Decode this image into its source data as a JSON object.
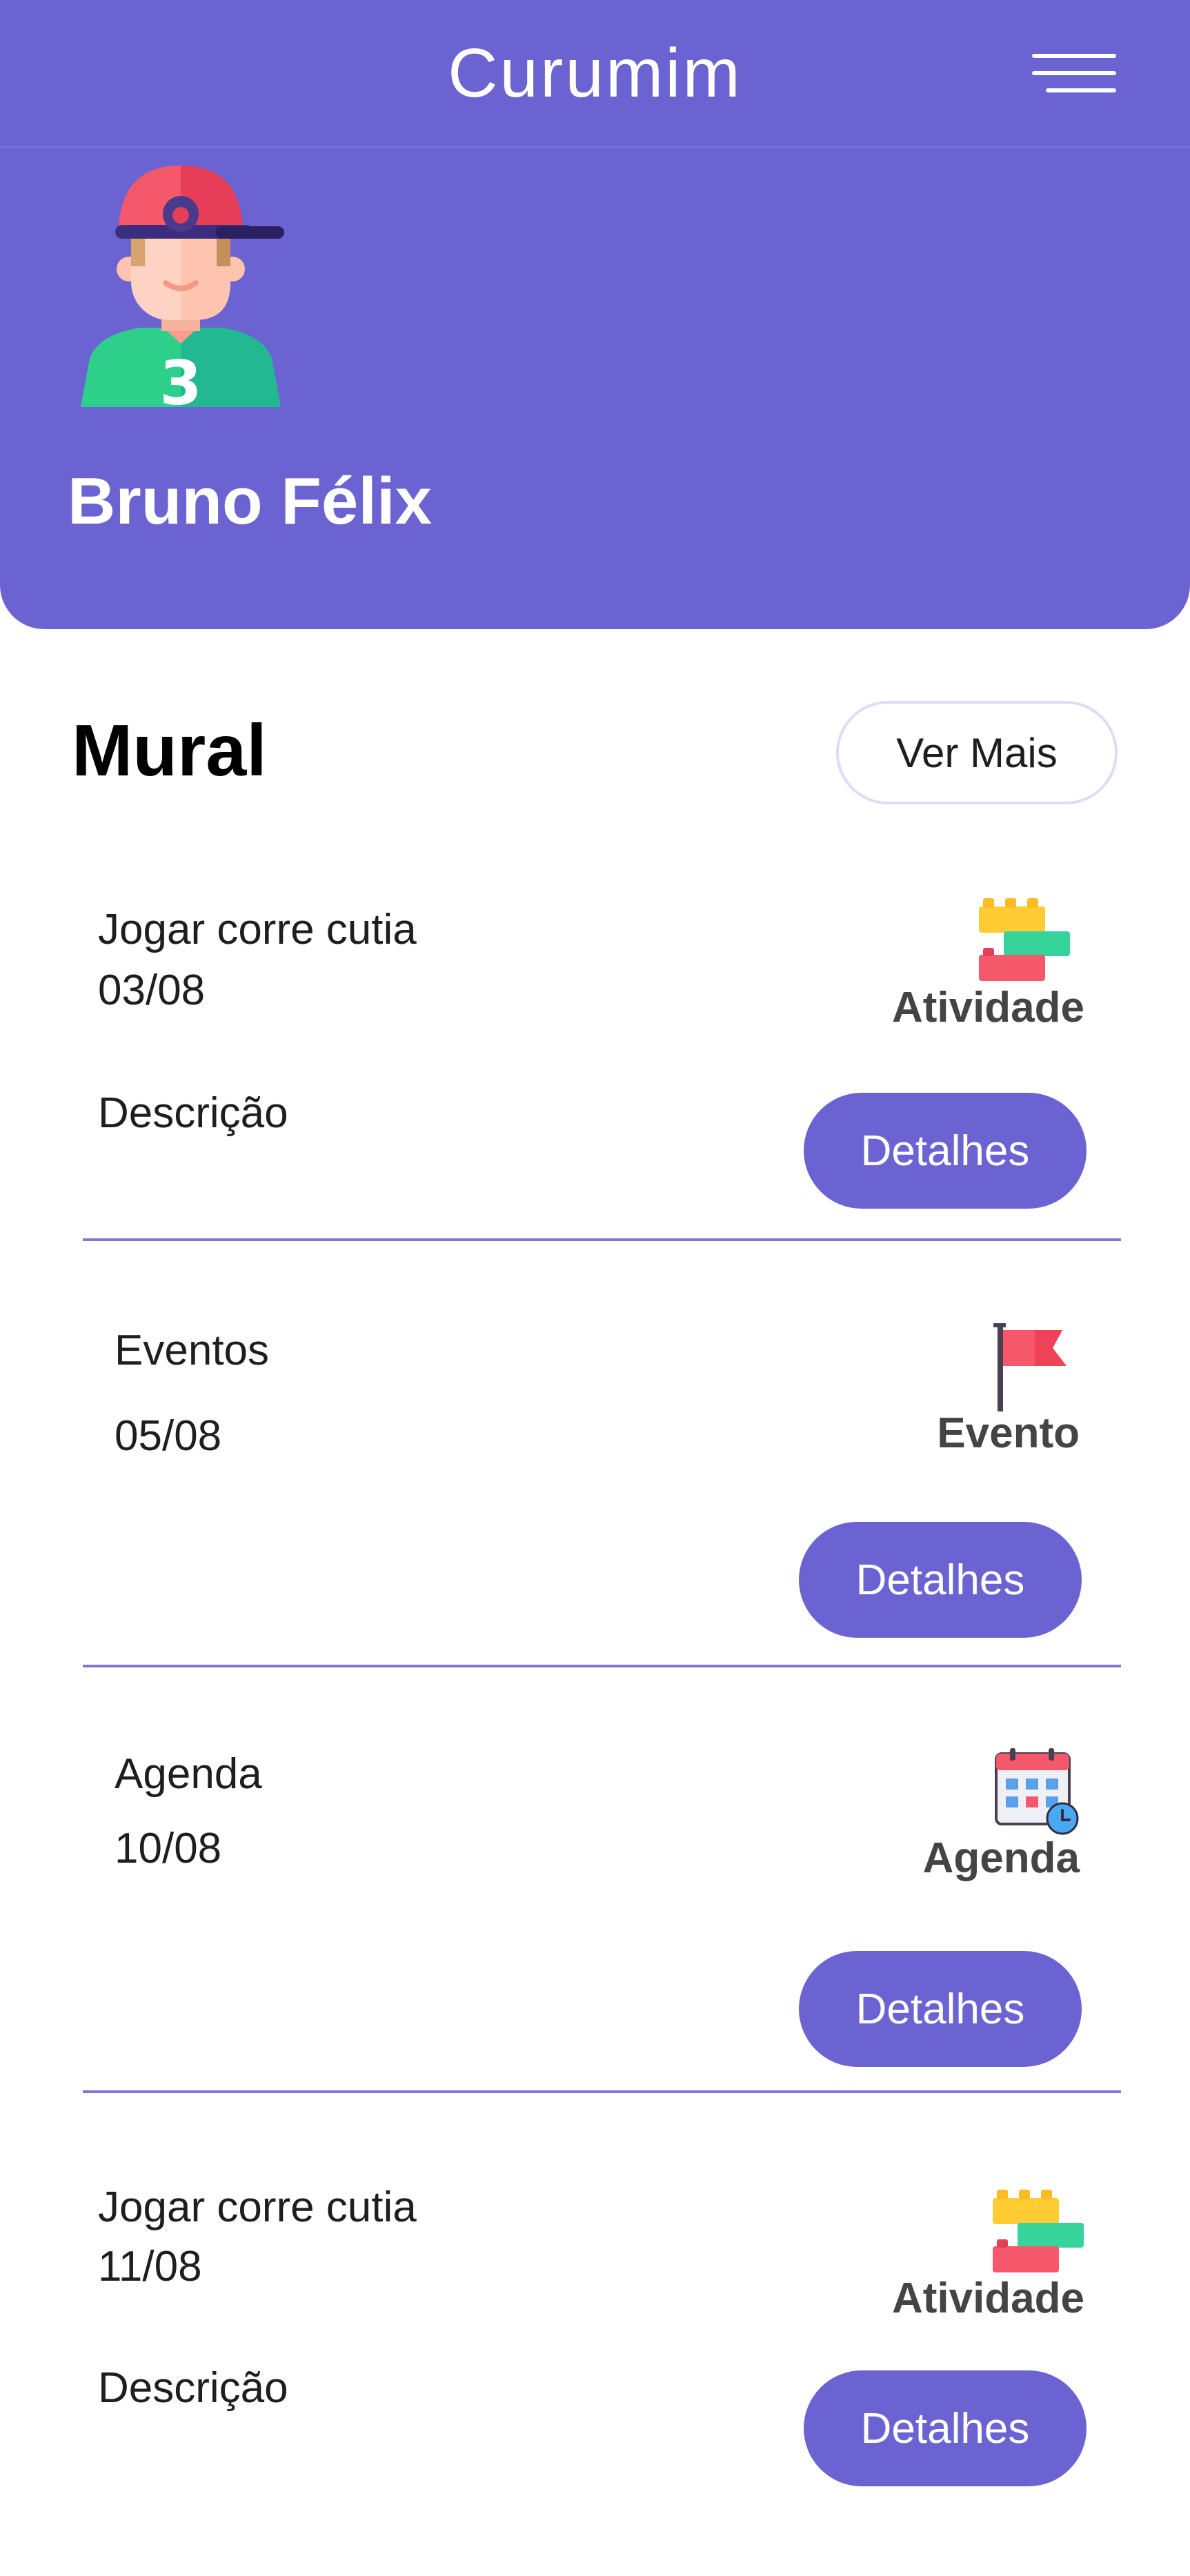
{
  "header": {
    "title": "Curumim",
    "menu_icon": "hamburger-menu-icon"
  },
  "profile": {
    "name": "Bruno Félix",
    "avatar_icon": "boy-with-cap-avatar-icon"
  },
  "feed": {
    "title": "Mural",
    "more_label": "Ver Mais",
    "items": [
      {
        "title": "Jogar corre cutia",
        "date": "03/08",
        "description": "Descrição",
        "type": "Atividade",
        "icon": "building-blocks-icon",
        "button": "Detalhes"
      },
      {
        "title": "Eventos",
        "date": "05/08",
        "description": "",
        "type": "Evento",
        "icon": "red-flag-icon",
        "button": "Detalhes"
      },
      {
        "title": "Agenda",
        "date": "10/08",
        "description": "",
        "type": "Agenda",
        "icon": "calendar-clock-icon",
        "button": "Detalhes"
      },
      {
        "title": "Jogar corre cutia",
        "date": "11/08",
        "description": "Descrição",
        "type": "Atividade",
        "icon": "building-blocks-icon",
        "button": "Detalhes"
      }
    ]
  },
  "colors": {
    "primary": "#6c63d2",
    "white": "#ffffff",
    "text": "#1e1e1e",
    "type_label": "#444444"
  }
}
